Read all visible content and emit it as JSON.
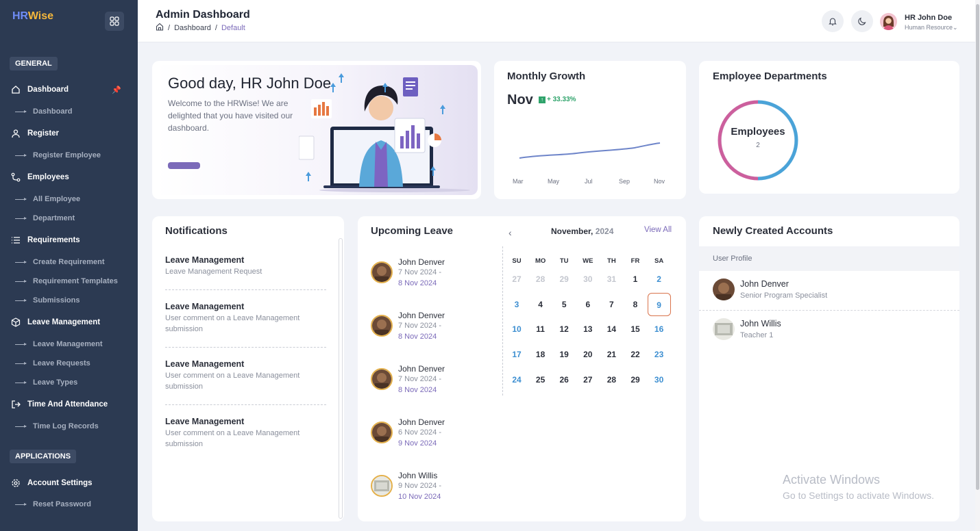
{
  "brand": {
    "hr": "HR",
    "wise": "Wise"
  },
  "sidebar": {
    "general_label": "GENERAL",
    "applications_label": "APPLICATIONS",
    "items": [
      {
        "label": "Dashboard",
        "icon": "home-icon"
      },
      {
        "label": "Dashboard"
      },
      {
        "label": "Register",
        "icon": "user-icon"
      },
      {
        "label": "Register Employee"
      },
      {
        "label": "Employees",
        "icon": "route-icon"
      },
      {
        "label": "All Employee"
      },
      {
        "label": "Department"
      },
      {
        "label": "Requirements",
        "icon": "list-icon"
      },
      {
        "label": "Create Requirement"
      },
      {
        "label": "Requirement Templates"
      },
      {
        "label": "Submissions"
      },
      {
        "label": "Leave Management",
        "icon": "box-icon"
      },
      {
        "label": "Leave Management"
      },
      {
        "label": "Leave Requests"
      },
      {
        "label": "Leave Types"
      },
      {
        "label": "Time And Attendance",
        "icon": "login-icon"
      },
      {
        "label": "Time Log Records"
      },
      {
        "label": "Account Settings",
        "icon": "gear-icon"
      },
      {
        "label": "Reset Password"
      }
    ]
  },
  "header": {
    "title": "Admin Dashboard",
    "breadcrumb": [
      "Dashboard",
      "Default"
    ],
    "user_name": "HR John Doe",
    "user_role": "Human Resource"
  },
  "welcome": {
    "greeting": "Good day, HR John Doe",
    "text": "Welcome to the HRWise! We are delighted that you have visited our dashboard."
  },
  "growth": {
    "title": "Monthly Growth",
    "month": "Nov",
    "change": "+ 33.33%",
    "months": [
      "Mar",
      "May",
      "Jul",
      "Sep",
      "Nov"
    ]
  },
  "departments": {
    "title": "Employee Departments",
    "label": "Employees",
    "value": "2",
    "colors": [
      "#cc5f9d",
      "#4aa3d8"
    ]
  },
  "notifications": {
    "title": "Notifications",
    "items": [
      {
        "title": "Leave Management",
        "desc": "Leave Management Request"
      },
      {
        "title": "Leave Management",
        "desc": "User comment on a Leave Management submission"
      },
      {
        "title": "Leave Management",
        "desc": "User comment on a Leave Management submission"
      },
      {
        "title": "Leave Management",
        "desc": "User comment on a Leave Management submission"
      }
    ]
  },
  "leave": {
    "title": "Upcoming Leave",
    "view_all": "View All",
    "month": "November,",
    "year": "2024",
    "items": [
      {
        "name": "John Denver",
        "from": "7 Nov 2024 -",
        "to": "8 Nov 2024"
      },
      {
        "name": "John Denver",
        "from": "7 Nov 2024 -",
        "to": "8 Nov 2024"
      },
      {
        "name": "John Denver",
        "from": "7 Nov 2024 -",
        "to": "8 Nov 2024"
      },
      {
        "name": "John Denver",
        "from": "6 Nov 2024 -",
        "to": "9 Nov 2024"
      },
      {
        "name": "John Willis",
        "from": "9 Nov 2024 -",
        "to": "10 Nov 2024"
      }
    ],
    "weekdays": [
      "SU",
      "MO",
      "TU",
      "WE",
      "TH",
      "FR",
      "SA"
    ],
    "weeks": [
      [
        "27",
        "28",
        "29",
        "30",
        "31",
        "1",
        "2"
      ],
      [
        "3",
        "4",
        "5",
        "6",
        "7",
        "8",
        "9"
      ],
      [
        "10",
        "11",
        "12",
        "13",
        "14",
        "15",
        "16"
      ],
      [
        "17",
        "18",
        "19",
        "20",
        "21",
        "22",
        "23"
      ],
      [
        "24",
        "25",
        "26",
        "27",
        "28",
        "29",
        "30"
      ]
    ],
    "today": "9"
  },
  "accounts": {
    "title": "Newly Created Accounts",
    "column": "User Profile",
    "rows": [
      {
        "name": "John Denver",
        "role": "Senior Program Specialist"
      },
      {
        "name": "John Willis",
        "role": "Teacher 1"
      }
    ]
  },
  "watermark": {
    "line1": "Activate Windows",
    "line2": "Go to Settings to activate Windows."
  }
}
